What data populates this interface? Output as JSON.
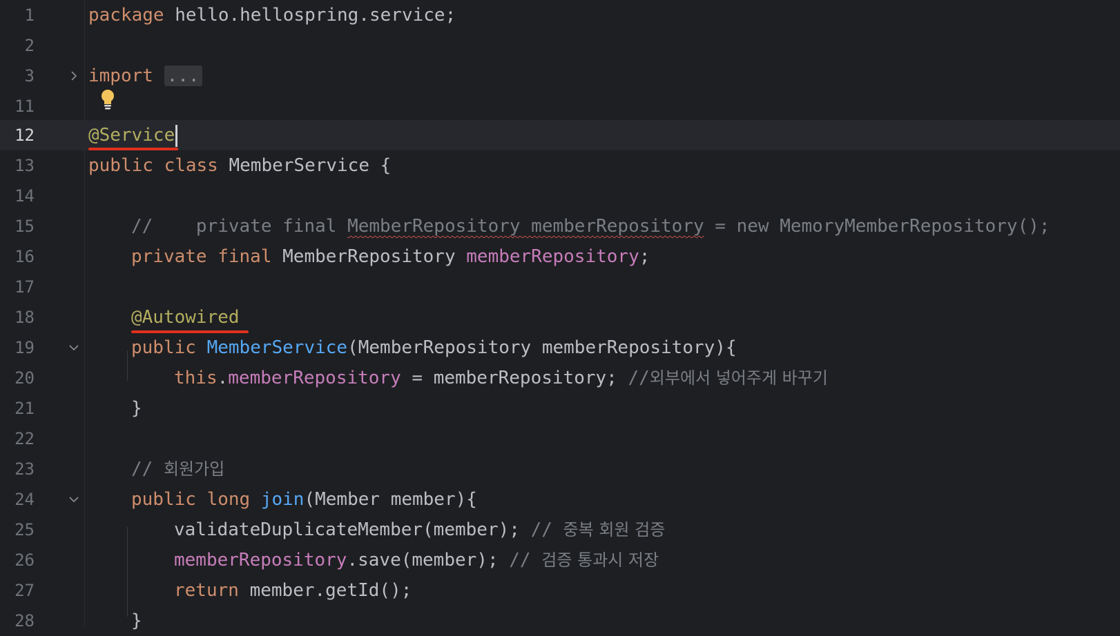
{
  "editor": {
    "current_line": "12",
    "lines": [
      {
        "n": "1"
      },
      {
        "n": "2"
      },
      {
        "n": "3"
      },
      {
        "n": "11"
      },
      {
        "n": "12"
      },
      {
        "n": "13"
      },
      {
        "n": "14"
      },
      {
        "n": "15"
      },
      {
        "n": "16"
      },
      {
        "n": "17"
      },
      {
        "n": "18"
      },
      {
        "n": "19"
      },
      {
        "n": "20"
      },
      {
        "n": "21"
      },
      {
        "n": "22"
      },
      {
        "n": "23"
      },
      {
        "n": "24"
      },
      {
        "n": "25"
      },
      {
        "n": "26"
      },
      {
        "n": "27"
      },
      {
        "n": "28"
      }
    ],
    "code": {
      "l1": {
        "kw": "package",
        "rest": " hello.hellospring.service;"
      },
      "l3": {
        "kw": "import",
        "folded": "..."
      },
      "l12": {
        "ann": "@Service"
      },
      "l13": {
        "kw": "public class",
        "rest": " MemberService {"
      },
      "l15": {
        "a": "//    private final ",
        "b": "MemberRepository memberRepository",
        "c": " = new MemoryMemberRepository();"
      },
      "l16": {
        "kw": "private final",
        "mid": " MemberRepository ",
        "fld": "memberRepository",
        "end": ";"
      },
      "l18": {
        "ann": "@Autowired"
      },
      "l19": {
        "kw": "public",
        "fn": "MemberService",
        "rest": "(MemberRepository memberRepository){"
      },
      "l20": {
        "kw": "this",
        "dot": ".",
        "fld": "memberRepository",
        "mid": " = memberRepository; ",
        "cm_prefix": "//",
        "cm_text": "외부에서 넣어주게 바꾸기"
      },
      "l21": {
        "text": "}"
      },
      "l23": {
        "cm_prefix": "// ",
        "cm_text": "회원가입"
      },
      "l24": {
        "kw": "public long",
        "fn": "join",
        "rest": "(Member member){"
      },
      "l25": {
        "rest": "validateDuplicateMember(member); ",
        "cm_prefix": "// ",
        "cm_text": "중복 회원 검증"
      },
      "l26": {
        "fld": "memberRepository",
        "rest": ".save(member); ",
        "cm_prefix": "// ",
        "cm_text": "검증 통과시 저장"
      },
      "l27": {
        "kw": "return",
        "rest": " member.getId();"
      },
      "l28": {
        "text": "}"
      }
    },
    "icons": {
      "fold_collapsed": "chevron-right-icon",
      "fold_expanded": "chevron-down-icon",
      "intention": "lightbulb-icon"
    },
    "colors": {
      "background": "#1e1f22",
      "keyword": "#cf8e6d",
      "annotation": "#b3ae60",
      "field": "#c77dbb",
      "function": "#56a8f5",
      "comment": "#7a7e85",
      "text": "#bcbec4",
      "highlight_underline": "#e0301e",
      "bulb": "#f2c55c"
    }
  }
}
